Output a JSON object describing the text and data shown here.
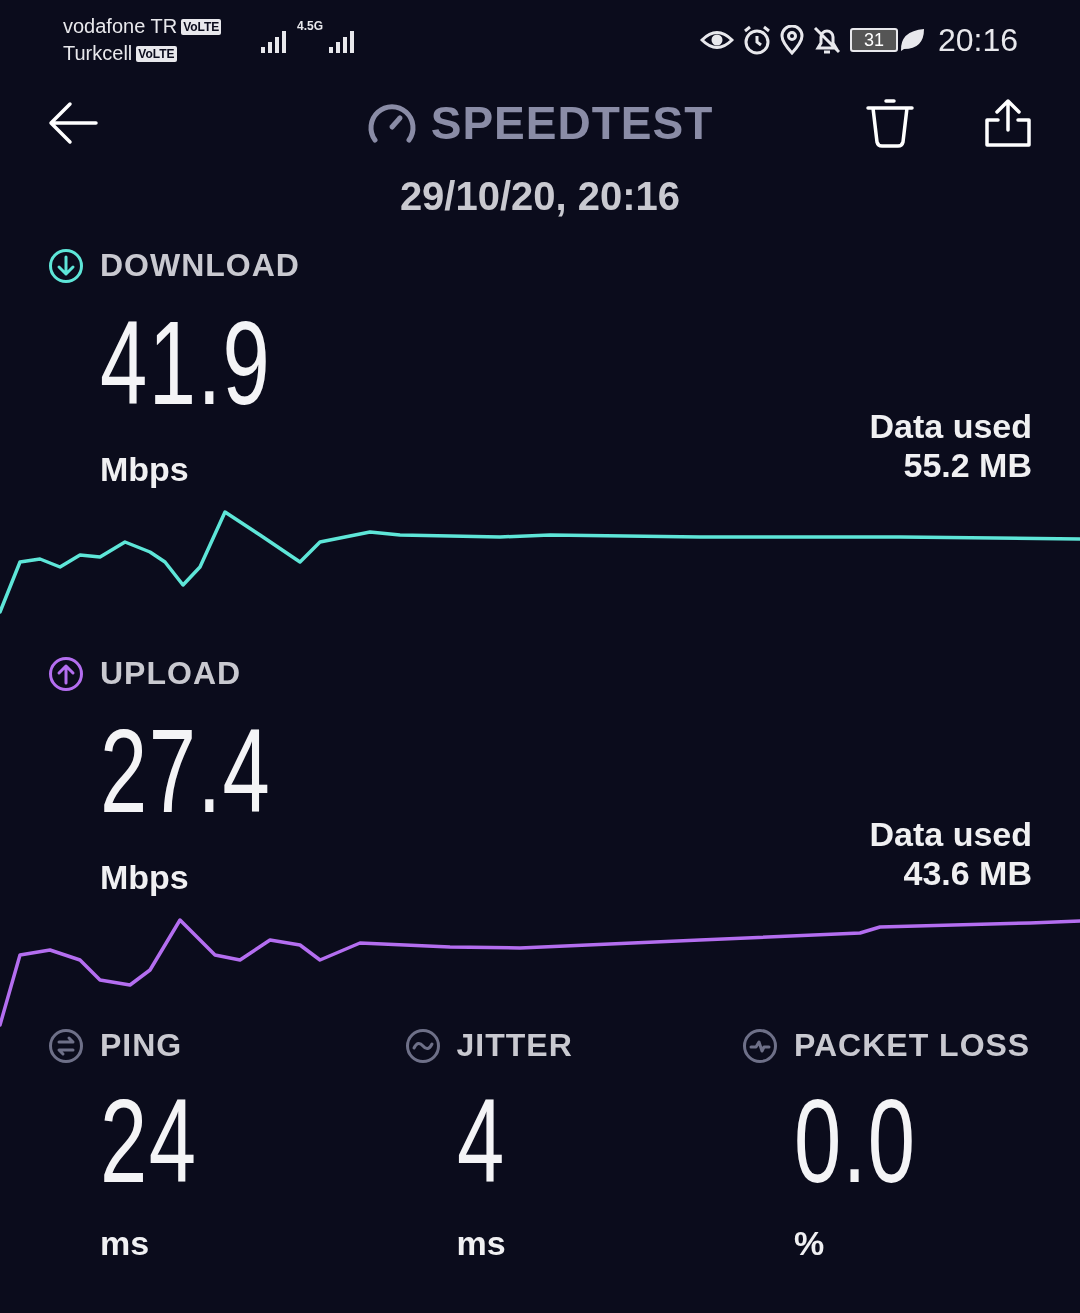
{
  "status_bar": {
    "carriers": [
      {
        "name": "vodafone TR",
        "badge": "VoLTE"
      },
      {
        "name": "Turkcell",
        "badge": "VoLTE"
      }
    ],
    "network": "4.5G",
    "battery": "31",
    "time": "20:16"
  },
  "header": {
    "title": "SPEEDTEST",
    "date": "29/10/20, 20:16"
  },
  "tests": [
    {
      "kind": "download",
      "label": "DOWNLOAD",
      "value": "41.9",
      "unit": "Mbps",
      "data_used_label": "Data used",
      "data_used": "55.2 MB",
      "color": "#5ee6d8"
    },
    {
      "kind": "upload",
      "label": "UPLOAD",
      "value": "27.4",
      "unit": "Mbps",
      "data_used_label": "Data used",
      "data_used": "43.6 MB",
      "color": "#b46ef0"
    }
  ],
  "stats": [
    {
      "kind": "ping",
      "label": "PING",
      "value": "24",
      "unit": "ms"
    },
    {
      "kind": "jitter",
      "label": "JITTER",
      "value": "4",
      "unit": "ms"
    },
    {
      "kind": "packet_loss",
      "label": "PACKET LOSS",
      "value": "0.0",
      "unit": "%"
    }
  ]
}
